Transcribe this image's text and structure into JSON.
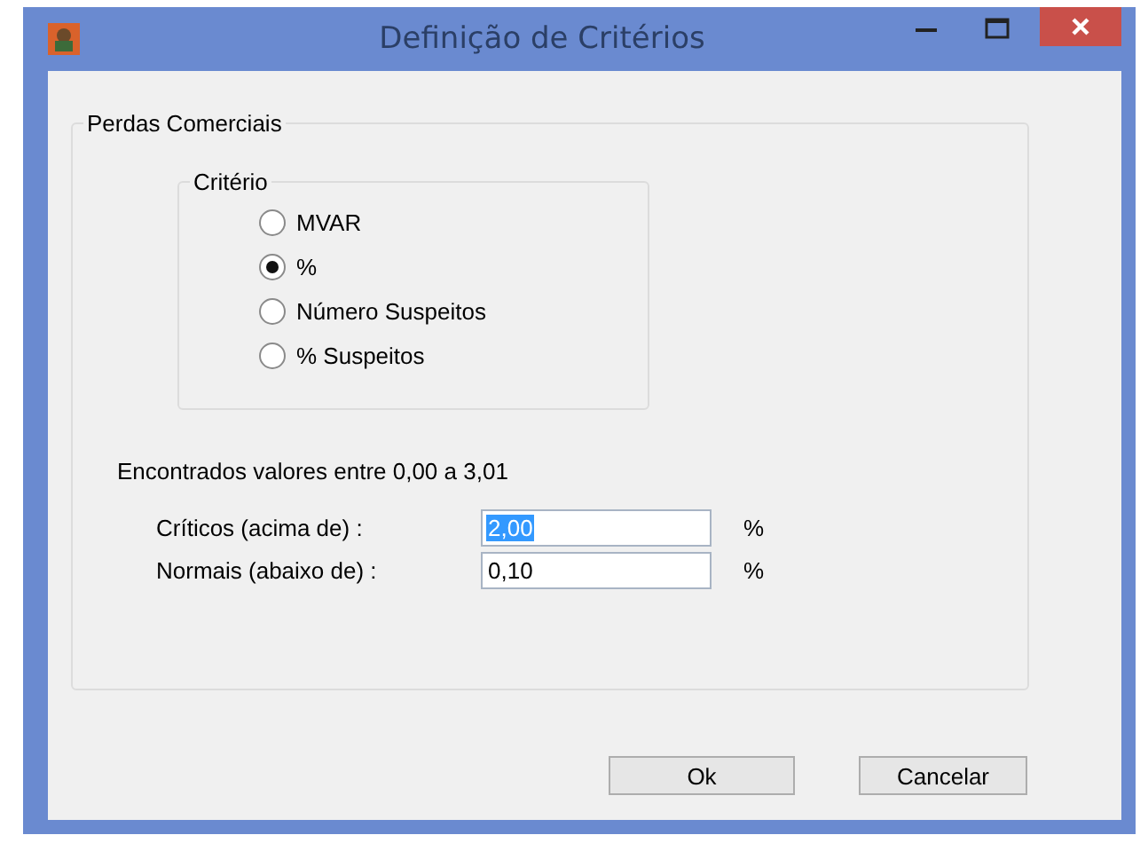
{
  "window": {
    "title": "Definição de Critérios"
  },
  "group": {
    "title": "Perdas Comerciais"
  },
  "criteria": {
    "title": "Critério",
    "options": [
      {
        "label": "MVAR",
        "selected": false
      },
      {
        "label": "%",
        "selected": true
      },
      {
        "label": "Número Suspeitos",
        "selected": false
      },
      {
        "label": "% Suspeitos",
        "selected": false
      }
    ]
  },
  "range_text": "Encontrados valores entre 0,00 a 3,01",
  "fields": [
    {
      "label": "Críticos (acima de) :",
      "value": "2,00",
      "highlighted": true,
      "unit": "%"
    },
    {
      "label": "Normais (abaixo de) :",
      "value": "0,10",
      "highlighted": false,
      "unit": "%"
    }
  ],
  "buttons": [
    "Ok",
    "Cancelar"
  ]
}
